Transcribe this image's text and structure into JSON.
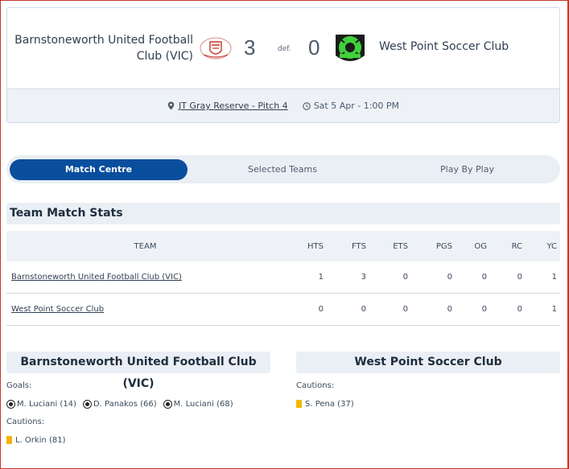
{
  "match": {
    "home_team": "Barnstoneworth United Football Club (VIC)",
    "away_team": "West Point Soccer Club",
    "home_score": "3",
    "away_score": "0",
    "result_label": "def.",
    "venue": "JT Gray Reserve - Pitch 4",
    "datetime": "Sat 5 Apr - 1:00 PM"
  },
  "tabs": [
    {
      "label": "Match Centre",
      "active": true
    },
    {
      "label": "Selected Teams",
      "active": false
    },
    {
      "label": "Play By Play",
      "active": false
    }
  ],
  "stats": {
    "title": "Team Match Stats",
    "headers": [
      "TEAM",
      "HTS",
      "FTS",
      "ETS",
      "PGS",
      "OG",
      "RC",
      "YC"
    ],
    "rows": [
      {
        "team": "Barnstoneworth United Football Club (VIC)",
        "values": [
          "1",
          "3",
          "0",
          "0",
          "0",
          "0",
          "1"
        ]
      },
      {
        "team": "West Point Soccer Club",
        "values": [
          "0",
          "0",
          "0",
          "0",
          "0",
          "0",
          "1"
        ]
      }
    ]
  },
  "home_events": {
    "title": "Barnstoneworth United Football Club (VIC)",
    "goals_label": "Goals:",
    "goals": [
      "M. Luciani (14)",
      "D. Panakos (66)",
      "M. Luciani (68)"
    ],
    "cautions_label": "Cautions:",
    "cautions": [
      "L. Orkin (81)"
    ]
  },
  "away_events": {
    "title": "West Point Soccer Club",
    "cautions_label": "Cautions:",
    "cautions": [
      "S. Pena (37)"
    ]
  },
  "colors": {
    "accent": "#0a4e9e",
    "panel": "#eaeff5",
    "caution": "#f2b705",
    "away_logo": "#3fd13a"
  },
  "icons": [
    "map-pin-icon",
    "clock-icon",
    "soccer-ball-icon",
    "yellow-card-icon"
  ]
}
